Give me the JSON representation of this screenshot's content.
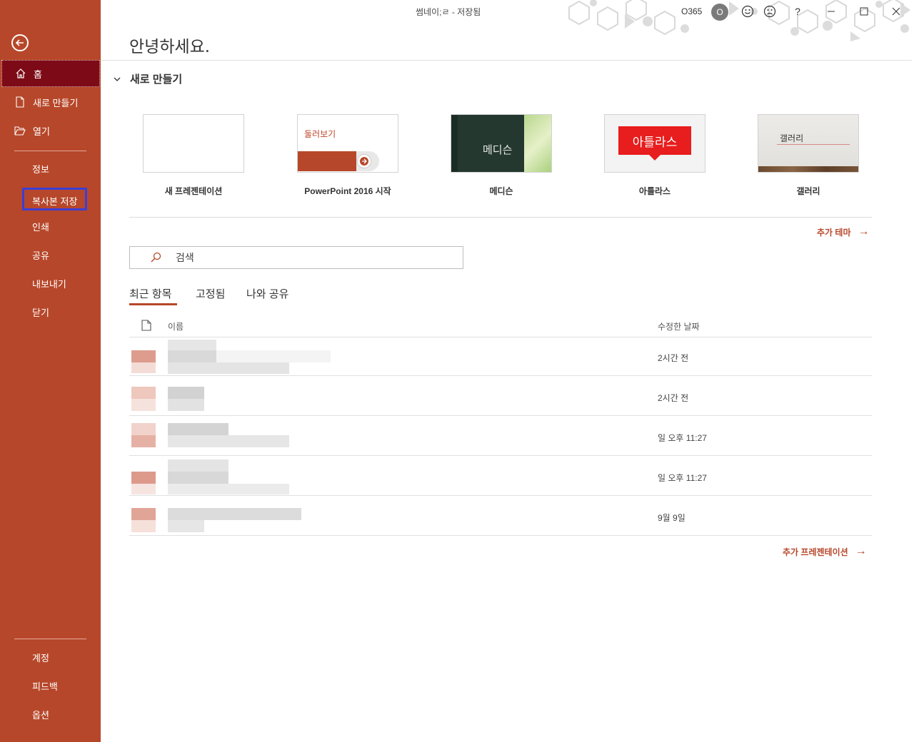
{
  "window": {
    "title": "썸네이;ㄹ - 저장됨",
    "account": "O365",
    "avatar_initial": "O"
  },
  "sidebar": {
    "home": "홈",
    "new": "새로 만들기",
    "open": "열기",
    "info": "정보",
    "save_copy": "복사본 저장",
    "print": "인쇄",
    "share": "공유",
    "export": "내보내기",
    "close": "닫기",
    "account": "계정",
    "feedback": "피드백",
    "options": "옵션"
  },
  "main": {
    "greeting": "안녕하세요.",
    "new_section": "새로 만들기",
    "templates": [
      {
        "name": "새 프레젠테이션",
        "thumb_text": ""
      },
      {
        "name": "PowerPoint 2016 시작",
        "thumb_text": "둘러보기"
      },
      {
        "name": "메디슨",
        "thumb_text": "메디슨"
      },
      {
        "name": "아틀라스",
        "thumb_text": "아틀라스"
      },
      {
        "name": "갤러리",
        "thumb_text": "갤러리"
      }
    ],
    "more_themes": "추가 테마",
    "search_placeholder": "검색",
    "tabs": [
      "최근 항목",
      "고정됨",
      "나와 공유"
    ],
    "columns": {
      "name": "이름",
      "modified": "수정한 날짜"
    },
    "recent": [
      {
        "modified": "2시간 전"
      },
      {
        "modified": "2시간 전"
      },
      {
        "modified": "일 오후 11:27"
      },
      {
        "modified": "일 오후 11:27"
      },
      {
        "modified": "9월 9일"
      }
    ],
    "more_presentations": "추가 프레젠테이션"
  },
  "colors": {
    "accent": "#b7472a",
    "home_selected": "#7d0b17",
    "highlight_box": "#3b3fd6"
  }
}
